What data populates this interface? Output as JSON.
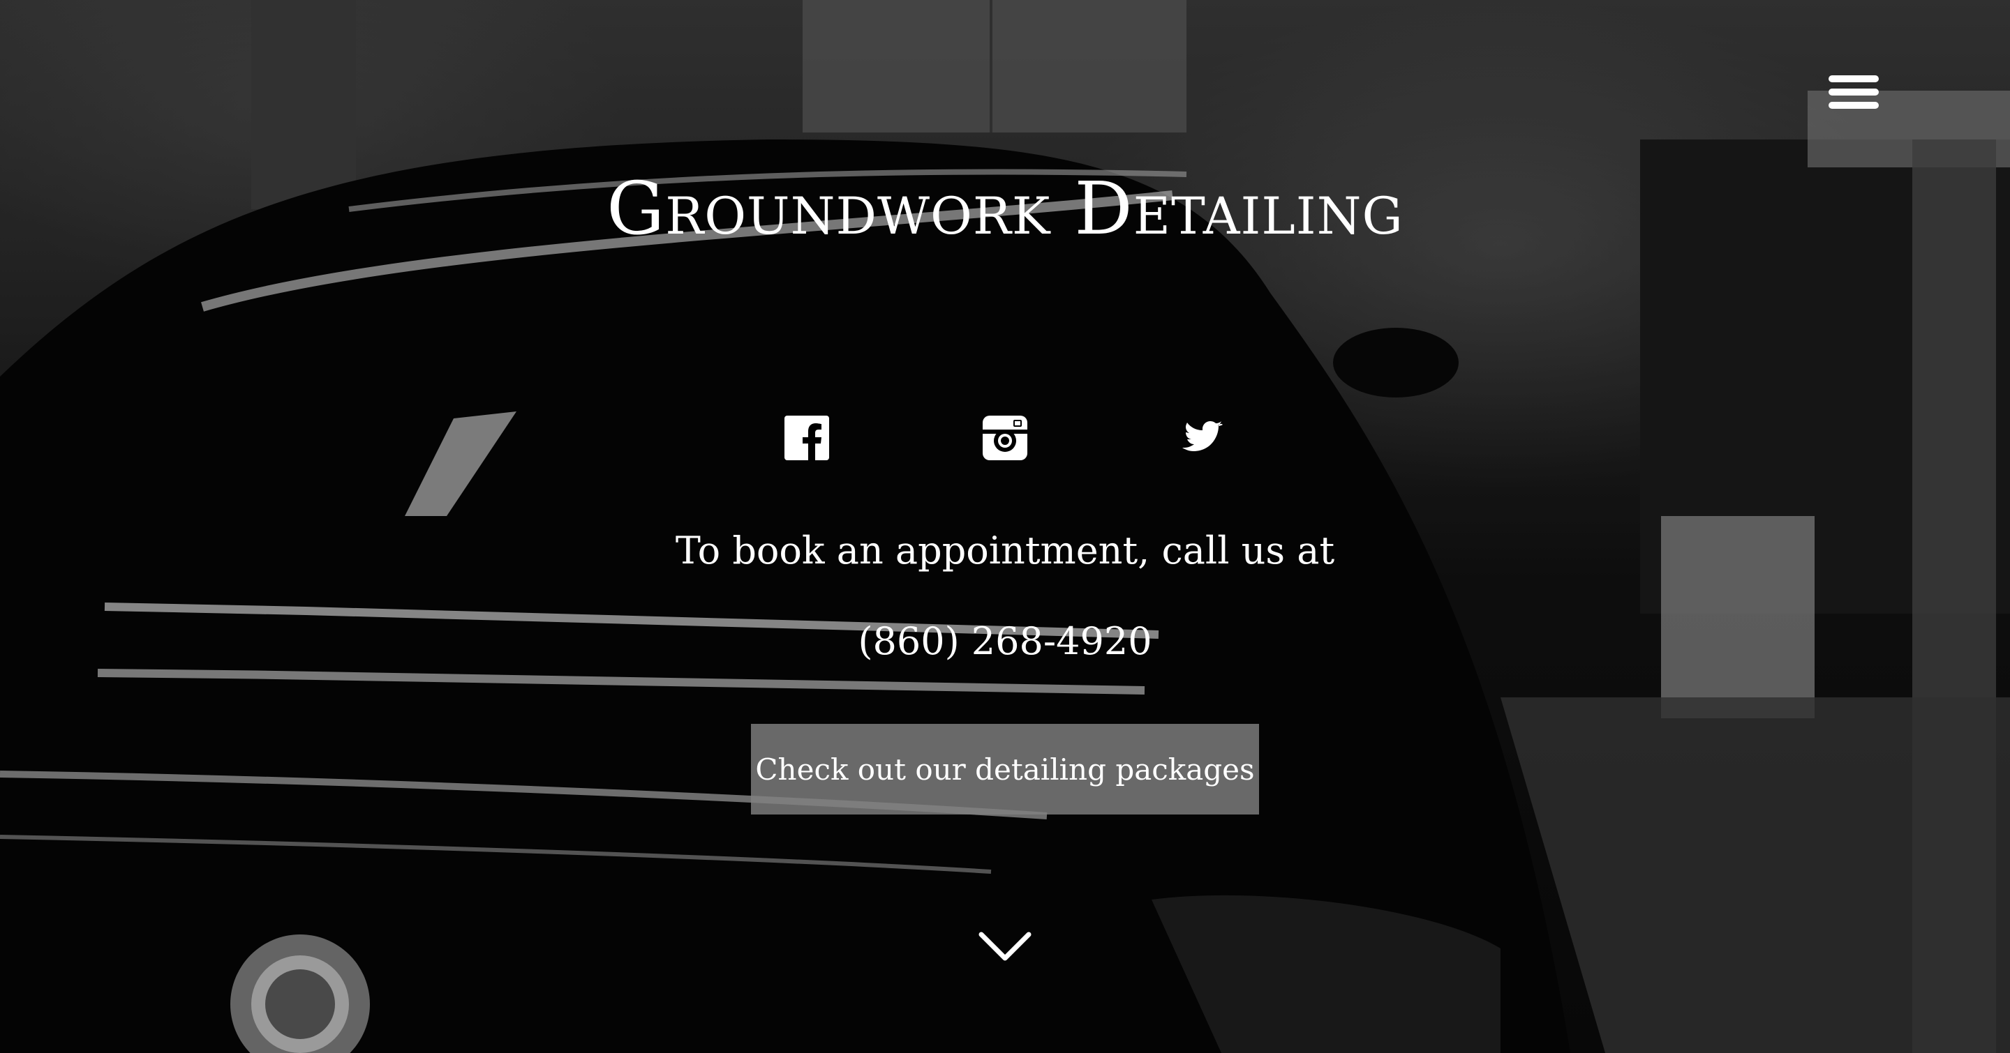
{
  "site": {
    "title": "Groundwork Detailing"
  },
  "header": {
    "menu_icon": "hamburger-menu-icon"
  },
  "social": [
    {
      "name": "Facebook",
      "icon": "facebook-icon"
    },
    {
      "name": "Instagram",
      "icon": "instagram-icon"
    },
    {
      "name": "Twitter",
      "icon": "twitter-icon"
    }
  ],
  "booking": {
    "text": "To book an appointment, call us at",
    "phone": "(860) 268-4920"
  },
  "cta": {
    "label": "Check out our detailing packages"
  },
  "scroll": {
    "icon": "chevron-down-icon"
  },
  "colors": {
    "text": "#ffffff",
    "button_bg": "#808080"
  }
}
